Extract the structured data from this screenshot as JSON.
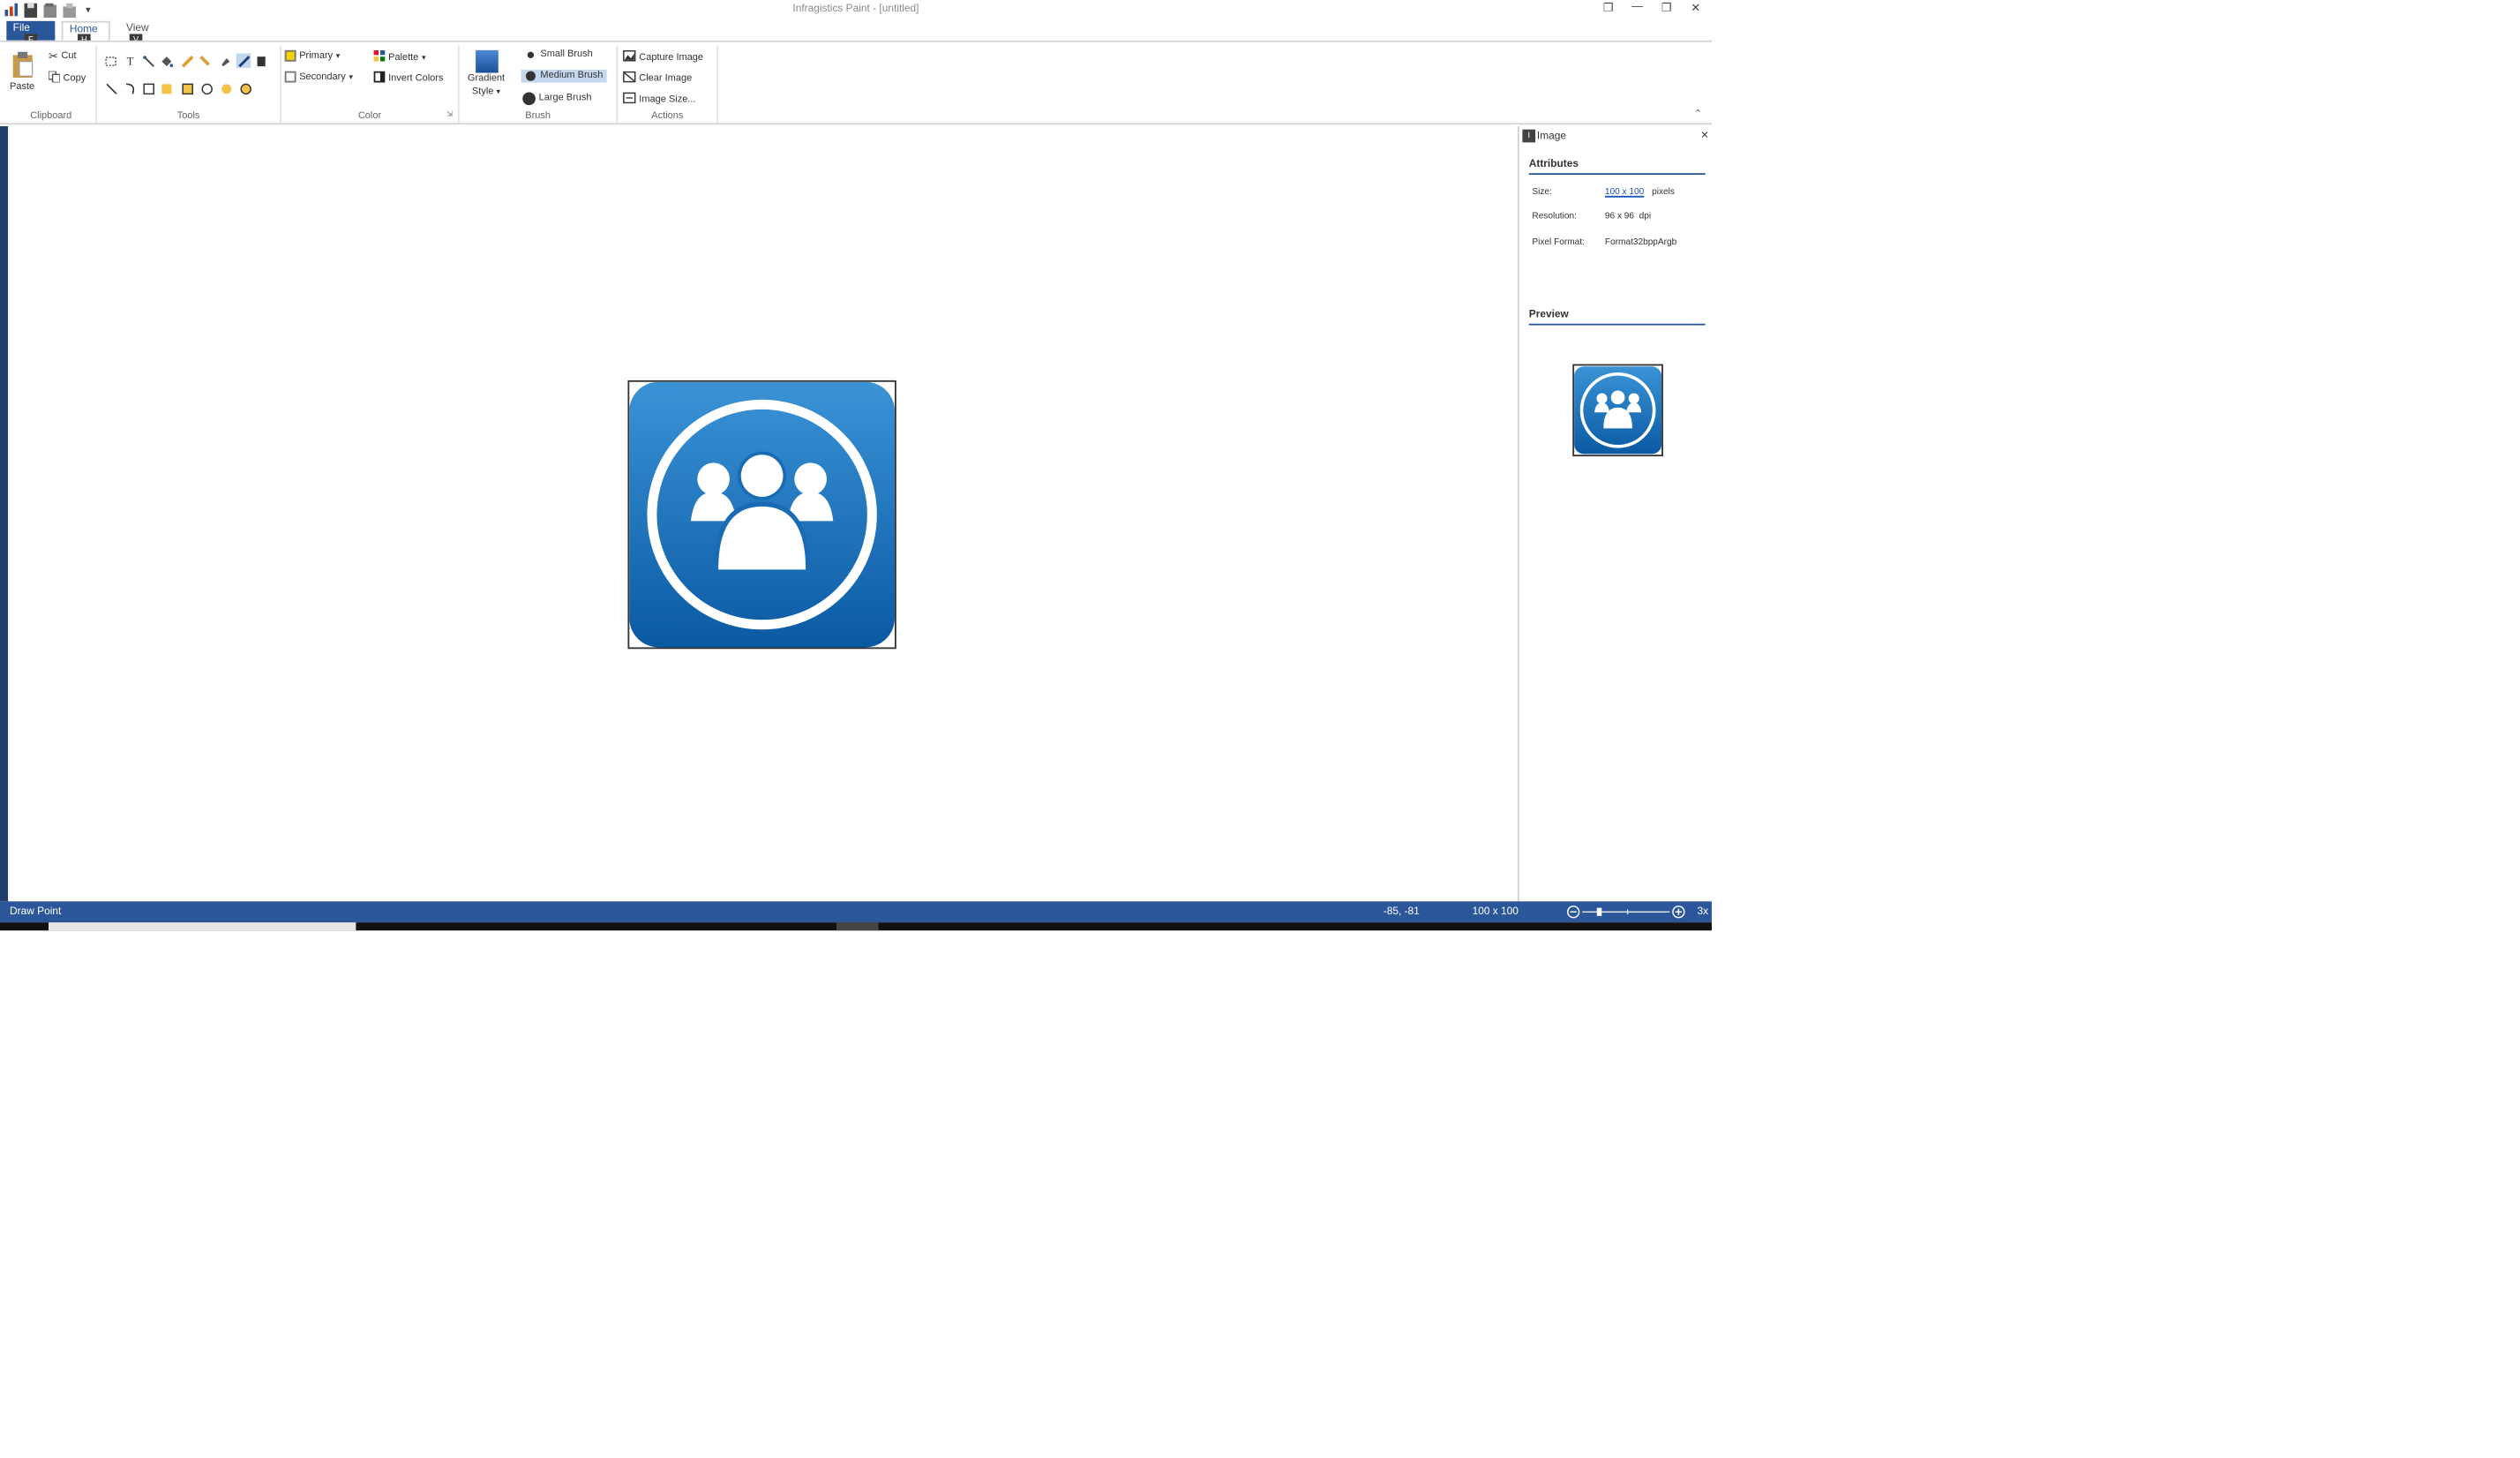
{
  "app": {
    "title": "Infragistics Paint - [untitled]",
    "window_buttons": [
      "❐",
      "—",
      "❒",
      "✕"
    ]
  },
  "tabs": {
    "file": "File",
    "home": "Home",
    "view": "View",
    "keytips": {
      "file": "F",
      "home": "H",
      "view": "V"
    }
  },
  "clipboard": {
    "paste": "Paste",
    "cut": "Cut",
    "copy": "Copy",
    "label": "Clipboard"
  },
  "tools": {
    "label": "Tools"
  },
  "color": {
    "primary": "Primary",
    "secondary": "Secondary",
    "palette": "Palette",
    "invert": "Invert Colors",
    "label": "Color"
  },
  "brush": {
    "gradient_line1": "Gradient",
    "gradient_line2": "Style",
    "small": "Small Brush",
    "medium": "Medium Brush",
    "large": "Large Brush",
    "label": "Brush"
  },
  "actions": {
    "capture": "Capture Image",
    "clear": "Clear Image",
    "size": "Image Size...",
    "label": "Actions"
  },
  "panel": {
    "title": "Image",
    "attributes_title": "Attributes",
    "size_label": "Size:",
    "size_value": "100 x 100",
    "size_unit": "pixels",
    "resolution_label": "Resolution:",
    "resolution_value": "96 x 96  dpi",
    "pixel_format_label": "Pixel Format:",
    "pixel_format_value": "Format32bppArgb",
    "preview_title": "Preview"
  },
  "status": {
    "mode": "Draw Point",
    "coords": "-85, -81",
    "dimensions": "100 x 100",
    "zoom": "3x"
  },
  "colors": {
    "accent": "#2b579a",
    "icon_blue_top": "#3b93d6",
    "icon_blue_bottom": "#0a5aa3"
  }
}
